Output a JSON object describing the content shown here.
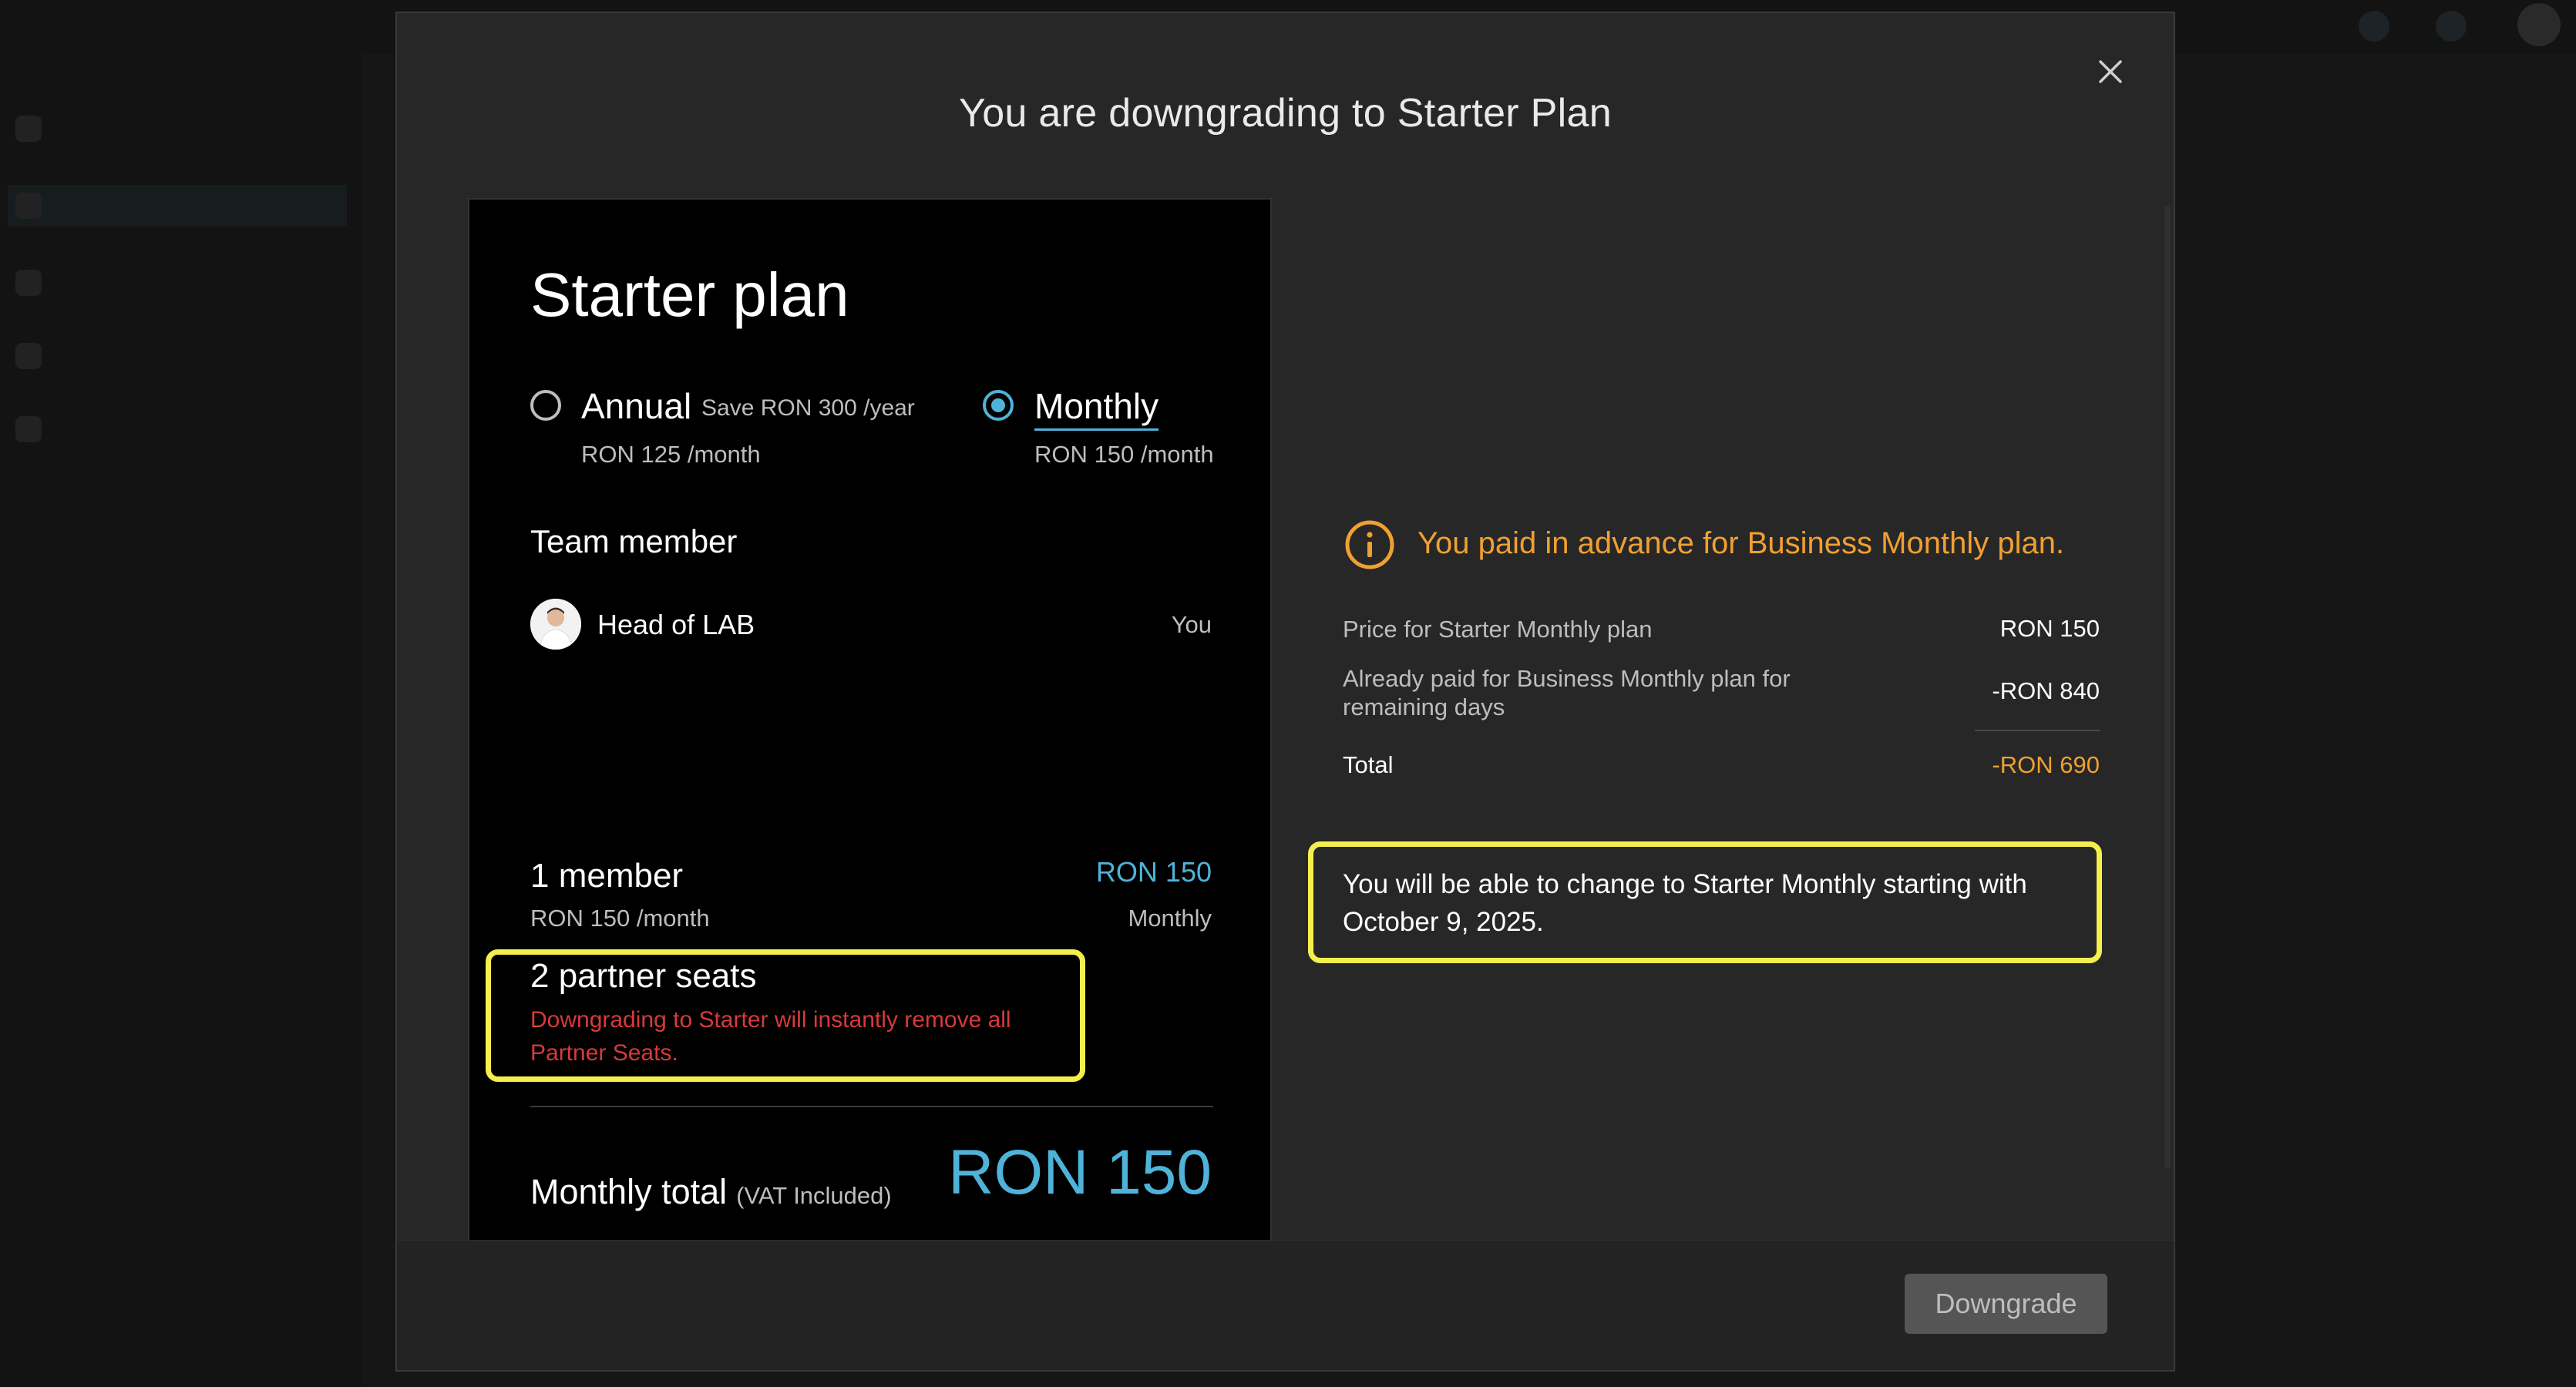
{
  "modal": {
    "title": "You are downgrading to Starter Plan"
  },
  "plan_card": {
    "title": "Starter plan",
    "options": [
      {
        "label": "Annual",
        "save_text": "Save RON 300 /year",
        "price": "RON 125 /month",
        "selected": false
      },
      {
        "label": "Monthly",
        "price": "RON 150 /month",
        "selected": true
      }
    ],
    "team_heading": "Team member",
    "member": {
      "name": "Head of LAB",
      "tag": "You"
    },
    "summary": {
      "members_label": "1 member",
      "members_price": "RON 150",
      "rate": "RON 150 /month",
      "cycle": "Monthly"
    },
    "partner": {
      "title": "2 partner seats",
      "warning": "Downgrading to Starter will instantly remove all Partner Seats."
    },
    "total": {
      "label": "Monthly total",
      "vat": "(VAT Included)",
      "price": "RON 150"
    }
  },
  "billing": {
    "info_message": "You paid in advance for Business Monthly plan.",
    "rows": [
      {
        "label": "Price for Starter Monthly plan",
        "value": "RON 150"
      },
      {
        "label": "Already paid for Business Monthly plan for remaining days",
        "value": "-RON 840"
      }
    ],
    "total_label": "Total",
    "total_value": "-RON 690",
    "notice": "You will be able to change to Starter Monthly starting with October 9, 2025."
  },
  "footer": {
    "downgrade_label": "Downgrade"
  },
  "colors": {
    "accent": "#4fb3d9",
    "warning_orange": "#f0a032",
    "error_red": "#d63a3a",
    "highlight": "#f5ef4e"
  }
}
